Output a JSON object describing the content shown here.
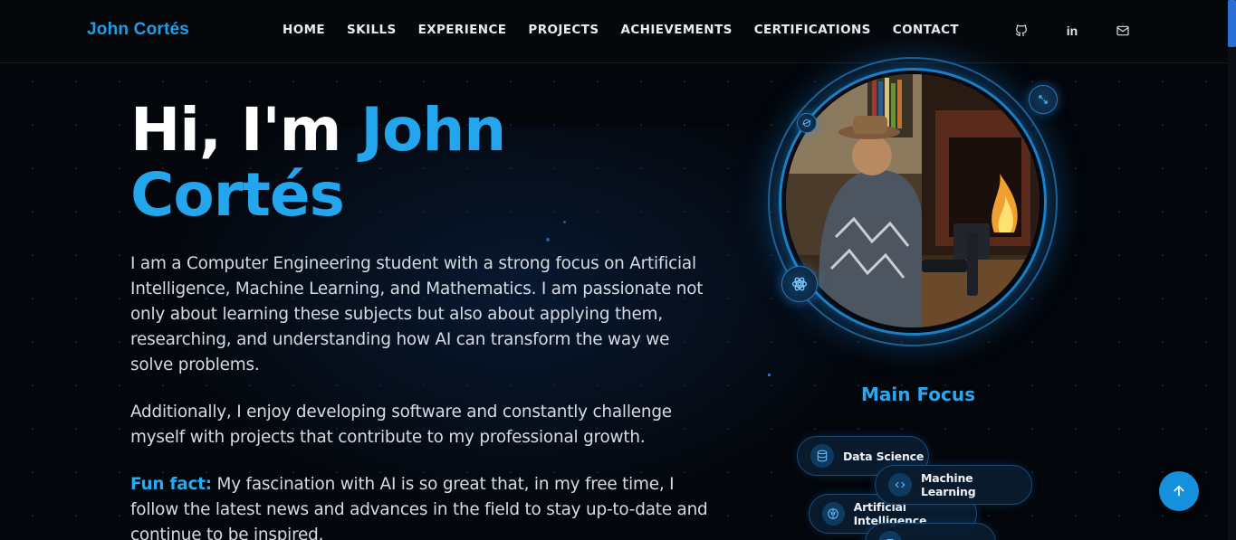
{
  "nav": {
    "brand": "John Cortés",
    "links": [
      "HOME",
      "SKILLS",
      "EXPERIENCE",
      "PROJECTS",
      "ACHIEVEMENTS",
      "CERTIFICATIONS",
      "CONTACT"
    ],
    "social": [
      {
        "name": "github-icon"
      },
      {
        "name": "linkedin-icon",
        "text": "in"
      },
      {
        "name": "mail-icon"
      }
    ]
  },
  "hero": {
    "greeting": "Hi, I'm ",
    "first_name": "John",
    "last_name": "Cortés",
    "paragraph1": "I am a Computer Engineering student with a strong focus on Artificial Intelligence, Machine Learning, and Mathematics. I am passionate not only about learning these subjects but also about applying them, researching, and understanding how AI can transform the way we solve problems.",
    "paragraph2": "Additionally, I enjoy developing software and constantly challenge myself with projects that contribute to my professional growth.",
    "fun_fact_label": "Fun fact:",
    "fun_fact_text": " My fascination with AI is so great that, in my free time, I follow the latest news and advances in the field to stay up-to-date and continue to be inspired."
  },
  "focus": {
    "title": "Main Focus",
    "chips": [
      {
        "label": "Data Science",
        "icon": "database-icon"
      },
      {
        "label": "Machine Learning",
        "icon": "code-icon"
      },
      {
        "label": "Artificial Intelligence",
        "icon": "brain-icon"
      },
      {
        "label": "",
        "icon": "chip-icon"
      }
    ]
  },
  "colors": {
    "accent": "#24a6ee",
    "background": "#03060b",
    "button": "#1490dc"
  }
}
